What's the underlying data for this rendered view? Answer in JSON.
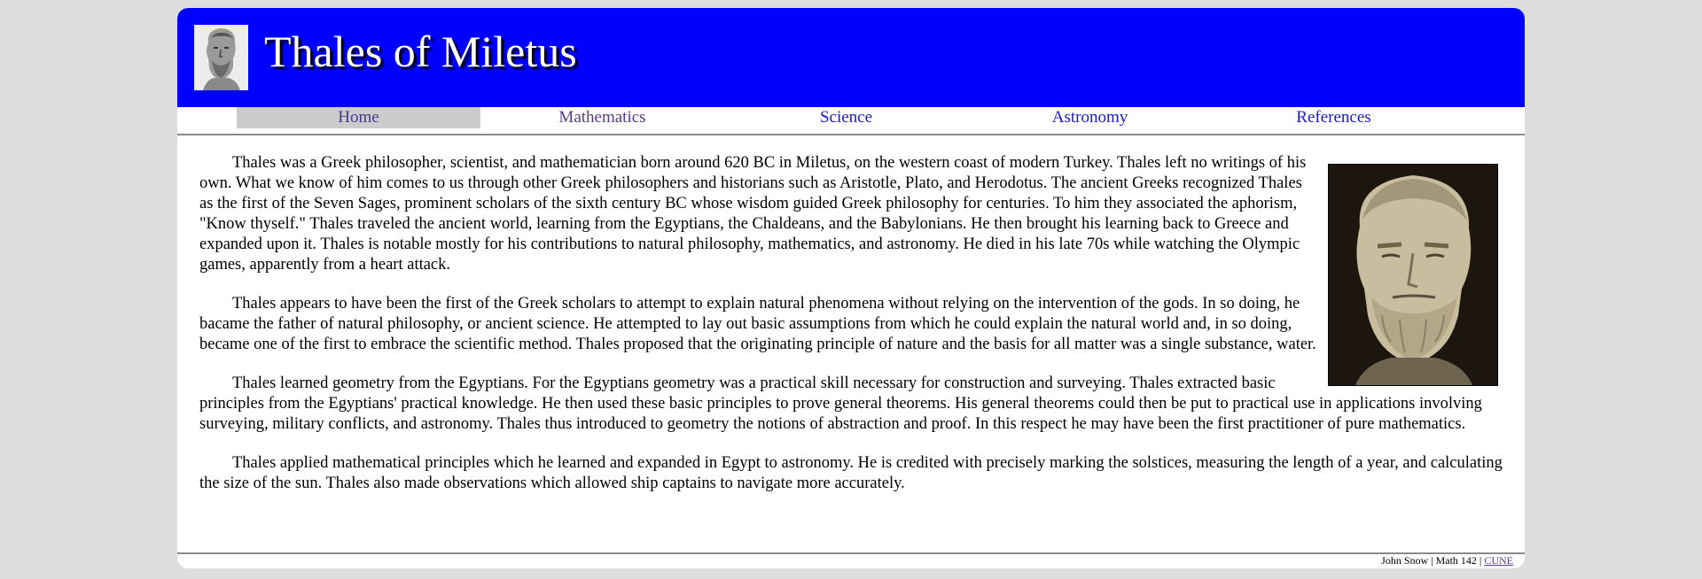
{
  "header": {
    "title": "Thales of Miletus",
    "logo_icon": "thales-portrait-icon"
  },
  "nav": {
    "items": [
      {
        "label": "Home",
        "state": "active"
      },
      {
        "label": "Mathematics",
        "state": "visited"
      },
      {
        "label": "Science",
        "state": "link"
      },
      {
        "label": "Astronomy",
        "state": "link"
      },
      {
        "label": "References",
        "state": "link"
      }
    ]
  },
  "content": {
    "paragraphs": [
      "Thales was a Greek philosopher, scientist, and mathematician born around 620 BC in Miletus, on the western coast of modern Turkey. Thales left no writings of his own. What we know of him comes to us through other Greek philosophers and historians such as Aristotle, Plato, and Herodotus. The ancient Greeks recognized Thales as the first of the Seven Sages, prominent scholars of the sixth century BC whose wisdom guided Greek philosophy for centuries. To him they associated the aphorism, \"Know thyself.\" Thales traveled the ancient world, learning from the Egyptians, the Chaldeans, and the Babylonians. He then brought his learning back to Greece and expanded upon it. Thales is notable mostly for his contributions to natural philosophy, mathematics, and astronomy. He died in his late 70s while watching the Olympic games, apparently from a heart attack.",
      "Thales appears to have been the first of the Greek scholars to attempt to explain natural phenomena without relying on the intervention of the gods. In so doing, he bacame the father of natural philosophy, or ancient science. He attempted to lay out basic assumptions from which he could explain the natural world and, in so doing, became one of the first to embrace the scientific method. Thales proposed that the originating principle of nature and the basis for all matter was a single substance, water.",
      "Thales learned geometry from the Egyptians. For the Egyptians geometry was a practical skill necessary for construction and surveying. Thales extracted basic principles from the Egyptians' practical knowledge. He then used these basic principles to prove general theorems. His general theorems could then be put to practical use in applications involving surveying, military conflicts, and astronomy. Thales thus introduced to geometry the notions of abstraction and proof. In this respect he may have been the first practitioner of pure mathematics.",
      "Thales applied mathematical principles which he learned and expanded in Egypt to astronomy. He is credited with precisely marking the solstices, measuring the length of a year, and calculating the size of the sun. Thales also made observations which allowed ship captains to navigate more accurately."
    ],
    "portrait_icon": "thales-bust-photo"
  },
  "footer": {
    "author": "John Snow | Math 142 |",
    "link": "CUNE"
  },
  "colors": {
    "header_bg": "#0000ff",
    "page_bg": "#dddddd",
    "nav_active_bg": "#cccccc",
    "link": "#1a1acc",
    "visited": "#5a3a8a"
  }
}
